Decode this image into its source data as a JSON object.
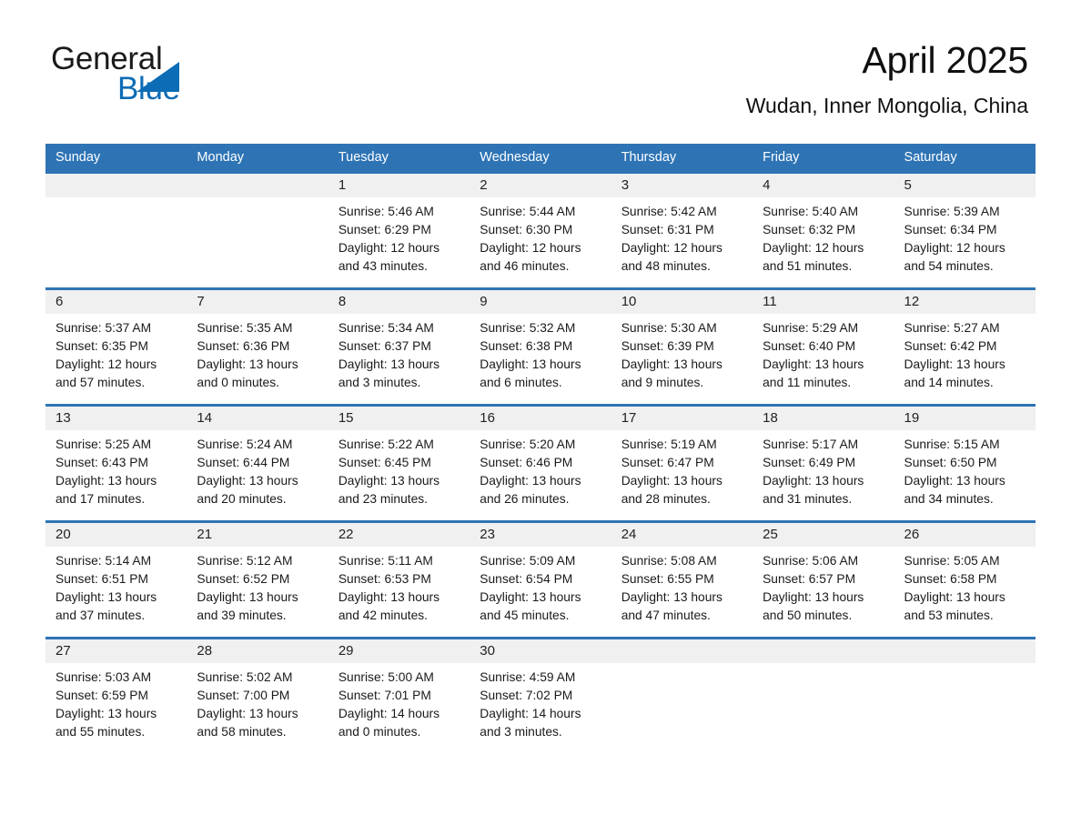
{
  "brand": {
    "name_part1": "General",
    "name_part2": "Blue",
    "triangle_color": "#0C6CB5",
    "text_color": "#1a1a1a"
  },
  "header": {
    "title": "April 2025",
    "subtitle": "Wudan, Inner Mongolia, China",
    "accent_color": "#2E74B5",
    "daynum_band_color": "#f0f0f0"
  },
  "weekdays": [
    "Sunday",
    "Monday",
    "Tuesday",
    "Wednesday",
    "Thursday",
    "Friday",
    "Saturday"
  ],
  "weeks": [
    [
      {
        "day": "",
        "sunrise": "",
        "sunset": "",
        "daylight_line1": "",
        "daylight_line2": ""
      },
      {
        "day": "",
        "sunrise": "",
        "sunset": "",
        "daylight_line1": "",
        "daylight_line2": ""
      },
      {
        "day": "1",
        "sunrise": "Sunrise: 5:46 AM",
        "sunset": "Sunset: 6:29 PM",
        "daylight_line1": "Daylight: 12 hours",
        "daylight_line2": "and 43 minutes."
      },
      {
        "day": "2",
        "sunrise": "Sunrise: 5:44 AM",
        "sunset": "Sunset: 6:30 PM",
        "daylight_line1": "Daylight: 12 hours",
        "daylight_line2": "and 46 minutes."
      },
      {
        "day": "3",
        "sunrise": "Sunrise: 5:42 AM",
        "sunset": "Sunset: 6:31 PM",
        "daylight_line1": "Daylight: 12 hours",
        "daylight_line2": "and 48 minutes."
      },
      {
        "day": "4",
        "sunrise": "Sunrise: 5:40 AM",
        "sunset": "Sunset: 6:32 PM",
        "daylight_line1": "Daylight: 12 hours",
        "daylight_line2": "and 51 minutes."
      },
      {
        "day": "5",
        "sunrise": "Sunrise: 5:39 AM",
        "sunset": "Sunset: 6:34 PM",
        "daylight_line1": "Daylight: 12 hours",
        "daylight_line2": "and 54 minutes."
      }
    ],
    [
      {
        "day": "6",
        "sunrise": "Sunrise: 5:37 AM",
        "sunset": "Sunset: 6:35 PM",
        "daylight_line1": "Daylight: 12 hours",
        "daylight_line2": "and 57 minutes."
      },
      {
        "day": "7",
        "sunrise": "Sunrise: 5:35 AM",
        "sunset": "Sunset: 6:36 PM",
        "daylight_line1": "Daylight: 13 hours",
        "daylight_line2": "and 0 minutes."
      },
      {
        "day": "8",
        "sunrise": "Sunrise: 5:34 AM",
        "sunset": "Sunset: 6:37 PM",
        "daylight_line1": "Daylight: 13 hours",
        "daylight_line2": "and 3 minutes."
      },
      {
        "day": "9",
        "sunrise": "Sunrise: 5:32 AM",
        "sunset": "Sunset: 6:38 PM",
        "daylight_line1": "Daylight: 13 hours",
        "daylight_line2": "and 6 minutes."
      },
      {
        "day": "10",
        "sunrise": "Sunrise: 5:30 AM",
        "sunset": "Sunset: 6:39 PM",
        "daylight_line1": "Daylight: 13 hours",
        "daylight_line2": "and 9 minutes."
      },
      {
        "day": "11",
        "sunrise": "Sunrise: 5:29 AM",
        "sunset": "Sunset: 6:40 PM",
        "daylight_line1": "Daylight: 13 hours",
        "daylight_line2": "and 11 minutes."
      },
      {
        "day": "12",
        "sunrise": "Sunrise: 5:27 AM",
        "sunset": "Sunset: 6:42 PM",
        "daylight_line1": "Daylight: 13 hours",
        "daylight_line2": "and 14 minutes."
      }
    ],
    [
      {
        "day": "13",
        "sunrise": "Sunrise: 5:25 AM",
        "sunset": "Sunset: 6:43 PM",
        "daylight_line1": "Daylight: 13 hours",
        "daylight_line2": "and 17 minutes."
      },
      {
        "day": "14",
        "sunrise": "Sunrise: 5:24 AM",
        "sunset": "Sunset: 6:44 PM",
        "daylight_line1": "Daylight: 13 hours",
        "daylight_line2": "and 20 minutes."
      },
      {
        "day": "15",
        "sunrise": "Sunrise: 5:22 AM",
        "sunset": "Sunset: 6:45 PM",
        "daylight_line1": "Daylight: 13 hours",
        "daylight_line2": "and 23 minutes."
      },
      {
        "day": "16",
        "sunrise": "Sunrise: 5:20 AM",
        "sunset": "Sunset: 6:46 PM",
        "daylight_line1": "Daylight: 13 hours",
        "daylight_line2": "and 26 minutes."
      },
      {
        "day": "17",
        "sunrise": "Sunrise: 5:19 AM",
        "sunset": "Sunset: 6:47 PM",
        "daylight_line1": "Daylight: 13 hours",
        "daylight_line2": "and 28 minutes."
      },
      {
        "day": "18",
        "sunrise": "Sunrise: 5:17 AM",
        "sunset": "Sunset: 6:49 PM",
        "daylight_line1": "Daylight: 13 hours",
        "daylight_line2": "and 31 minutes."
      },
      {
        "day": "19",
        "sunrise": "Sunrise: 5:15 AM",
        "sunset": "Sunset: 6:50 PM",
        "daylight_line1": "Daylight: 13 hours",
        "daylight_line2": "and 34 minutes."
      }
    ],
    [
      {
        "day": "20",
        "sunrise": "Sunrise: 5:14 AM",
        "sunset": "Sunset: 6:51 PM",
        "daylight_line1": "Daylight: 13 hours",
        "daylight_line2": "and 37 minutes."
      },
      {
        "day": "21",
        "sunrise": "Sunrise: 5:12 AM",
        "sunset": "Sunset: 6:52 PM",
        "daylight_line1": "Daylight: 13 hours",
        "daylight_line2": "and 39 minutes."
      },
      {
        "day": "22",
        "sunrise": "Sunrise: 5:11 AM",
        "sunset": "Sunset: 6:53 PM",
        "daylight_line1": "Daylight: 13 hours",
        "daylight_line2": "and 42 minutes."
      },
      {
        "day": "23",
        "sunrise": "Sunrise: 5:09 AM",
        "sunset": "Sunset: 6:54 PM",
        "daylight_line1": "Daylight: 13 hours",
        "daylight_line2": "and 45 minutes."
      },
      {
        "day": "24",
        "sunrise": "Sunrise: 5:08 AM",
        "sunset": "Sunset: 6:55 PM",
        "daylight_line1": "Daylight: 13 hours",
        "daylight_line2": "and 47 minutes."
      },
      {
        "day": "25",
        "sunrise": "Sunrise: 5:06 AM",
        "sunset": "Sunset: 6:57 PM",
        "daylight_line1": "Daylight: 13 hours",
        "daylight_line2": "and 50 minutes."
      },
      {
        "day": "26",
        "sunrise": "Sunrise: 5:05 AM",
        "sunset": "Sunset: 6:58 PM",
        "daylight_line1": "Daylight: 13 hours",
        "daylight_line2": "and 53 minutes."
      }
    ],
    [
      {
        "day": "27",
        "sunrise": "Sunrise: 5:03 AM",
        "sunset": "Sunset: 6:59 PM",
        "daylight_line1": "Daylight: 13 hours",
        "daylight_line2": "and 55 minutes."
      },
      {
        "day": "28",
        "sunrise": "Sunrise: 5:02 AM",
        "sunset": "Sunset: 7:00 PM",
        "daylight_line1": "Daylight: 13 hours",
        "daylight_line2": "and 58 minutes."
      },
      {
        "day": "29",
        "sunrise": "Sunrise: 5:00 AM",
        "sunset": "Sunset: 7:01 PM",
        "daylight_line1": "Daylight: 14 hours",
        "daylight_line2": "and 0 minutes."
      },
      {
        "day": "30",
        "sunrise": "Sunrise: 4:59 AM",
        "sunset": "Sunset: 7:02 PM",
        "daylight_line1": "Daylight: 14 hours",
        "daylight_line2": "and 3 minutes."
      },
      {
        "day": "",
        "sunrise": "",
        "sunset": "",
        "daylight_line1": "",
        "daylight_line2": ""
      },
      {
        "day": "",
        "sunrise": "",
        "sunset": "",
        "daylight_line1": "",
        "daylight_line2": ""
      },
      {
        "day": "",
        "sunrise": "",
        "sunset": "",
        "daylight_line1": "",
        "daylight_line2": ""
      }
    ]
  ]
}
